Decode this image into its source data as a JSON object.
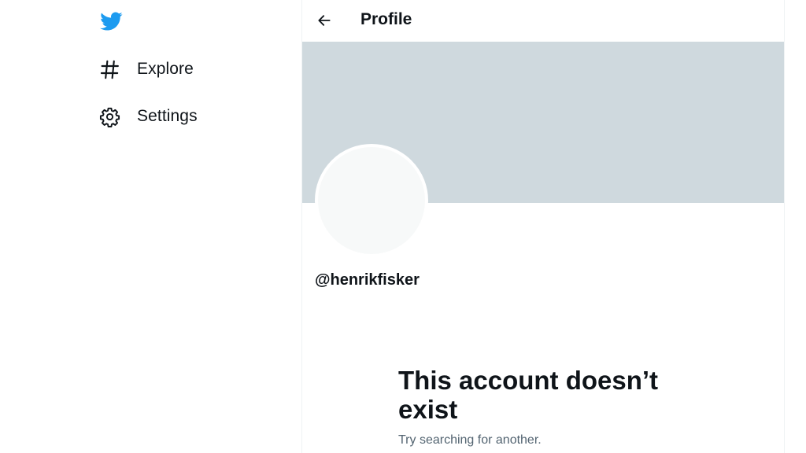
{
  "colors": {
    "brand": "#1d9bf0",
    "text_primary": "#0f1419",
    "text_secondary": "#536471",
    "banner": "#cfd9de",
    "avatar": "#f7f9f9",
    "border": "#eff3f4"
  },
  "nav": {
    "logo_icon": "twitter-bird-icon",
    "items": [
      {
        "label": "Explore",
        "icon": "hashtag-icon"
      },
      {
        "label": "Settings",
        "icon": "gear-icon"
      }
    ]
  },
  "header": {
    "back_icon": "arrow-left-icon",
    "title": "Profile"
  },
  "profile": {
    "handle": "@henrikfisker"
  },
  "empty_state": {
    "title": "This account doesn’t exist",
    "subtitle": "Try searching for another."
  }
}
